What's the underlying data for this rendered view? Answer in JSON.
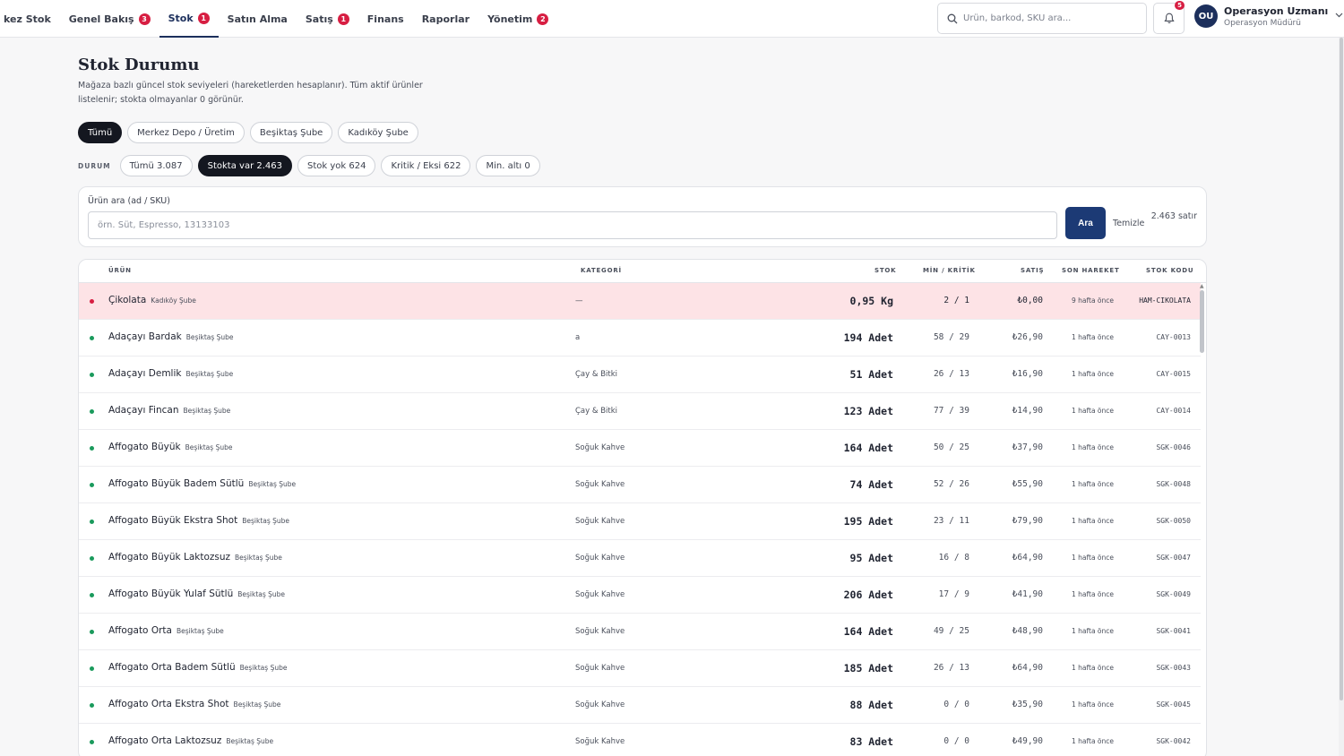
{
  "nav": {
    "items": [
      {
        "label": "kez Stok",
        "badge": ""
      },
      {
        "label": "Genel Bakış",
        "badge": "3"
      },
      {
        "label": "Stok",
        "badge": "1",
        "active": true
      },
      {
        "label": "Satın Alma",
        "badge": ""
      },
      {
        "label": "Satış",
        "badge": "1"
      },
      {
        "label": "Finans",
        "badge": ""
      },
      {
        "label": "Raporlar",
        "badge": ""
      },
      {
        "label": "Yönetim",
        "badge": "2"
      }
    ],
    "search_placeholder": "Ürün, barkod, SKU ara...",
    "notification_count": "5",
    "user": {
      "initials": "OU",
      "name": "Operasyon Uzmanı",
      "role": "Operasyon Müdürü"
    }
  },
  "header": {
    "title": "Stok Durumu",
    "description": "Mağaza bazlı güncel stok seviyeleri (hareketlerden hesaplanır). Tüm aktif ürünler listelenir; stokta olmayanlar 0 görünür."
  },
  "store_filters": [
    {
      "label": "Tümü",
      "active": true
    },
    {
      "label": "Merkez Depo / Üretim",
      "active": false
    },
    {
      "label": "Beşiktaş Şube",
      "active": false
    },
    {
      "label": "Kadıköy Şube",
      "active": false
    }
  ],
  "status": {
    "label": "DURUM",
    "filters": [
      {
        "label": "Tümü 3.087",
        "active": false
      },
      {
        "label": "Stokta var 2.463",
        "active": true
      },
      {
        "label": "Stok yok 624",
        "active": false
      },
      {
        "label": "Kritik / Eksi 622",
        "active": false
      },
      {
        "label": "Min. altı 0",
        "active": false
      }
    ]
  },
  "search": {
    "label": "Ürün ara (ad / SKU)",
    "placeholder": "örn. Süt, Espresso, 13133103",
    "value": "",
    "button": "Ara",
    "clear": "Temizle",
    "row_count": "2.463 satır"
  },
  "table": {
    "columns": {
      "product": "ÜRÜN",
      "category": "KATEGORİ",
      "stock": "STOK",
      "min": "MİN / KRİTİK",
      "price": "SATIŞ",
      "last": "SON HAREKET",
      "sku": "STOK KODU"
    },
    "rows": [
      {
        "name": "Çikolata",
        "store": "Kadıköy Şube",
        "category": "—",
        "stock": "0,95 Kg",
        "min": "2 / 1",
        "price": "₺0,00",
        "last": "9 hafta önce",
        "sku": "HAM-CIKOLATA",
        "status": "critical"
      },
      {
        "name": "Adaçayı Bardak",
        "store": "Beşiktaş Şube",
        "category": "a",
        "stock": "194 Adet",
        "min": "58 / 29",
        "price": "₺26,90",
        "last": "1 hafta önce",
        "sku": "CAY-0013",
        "status": "ok"
      },
      {
        "name": "Adaçayı Demlik",
        "store": "Beşiktaş Şube",
        "category": "Çay & Bitki",
        "stock": "51 Adet",
        "min": "26 / 13",
        "price": "₺16,90",
        "last": "1 hafta önce",
        "sku": "CAY-0015",
        "status": "ok"
      },
      {
        "name": "Adaçayı Fincan",
        "store": "Beşiktaş Şube",
        "category": "Çay & Bitki",
        "stock": "123 Adet",
        "min": "77 / 39",
        "price": "₺14,90",
        "last": "1 hafta önce",
        "sku": "CAY-0014",
        "status": "ok"
      },
      {
        "name": "Affogato Büyük",
        "store": "Beşiktaş Şube",
        "category": "Soğuk Kahve",
        "stock": "164 Adet",
        "min": "50 / 25",
        "price": "₺37,90",
        "last": "1 hafta önce",
        "sku": "SGK-0046",
        "status": "ok"
      },
      {
        "name": "Affogato Büyük Badem Sütlü",
        "store": "Beşiktaş Şube",
        "category": "Soğuk Kahve",
        "stock": "74 Adet",
        "min": "52 / 26",
        "price": "₺55,90",
        "last": "1 hafta önce",
        "sku": "SGK-0048",
        "status": "ok"
      },
      {
        "name": "Affogato Büyük Ekstra Shot",
        "store": "Beşiktaş Şube",
        "category": "Soğuk Kahve",
        "stock": "195 Adet",
        "min": "23 / 11",
        "price": "₺79,90",
        "last": "1 hafta önce",
        "sku": "SGK-0050",
        "status": "ok"
      },
      {
        "name": "Affogato Büyük Laktozsuz",
        "store": "Beşiktaş Şube",
        "category": "Soğuk Kahve",
        "stock": "95 Adet",
        "min": "16 / 8",
        "price": "₺64,90",
        "last": "1 hafta önce",
        "sku": "SGK-0047",
        "status": "ok"
      },
      {
        "name": "Affogato Büyük Yulaf Sütlü",
        "store": "Beşiktaş Şube",
        "category": "Soğuk Kahve",
        "stock": "206 Adet",
        "min": "17 / 9",
        "price": "₺41,90",
        "last": "1 hafta önce",
        "sku": "SGK-0049",
        "status": "ok"
      },
      {
        "name": "Affogato Orta",
        "store": "Beşiktaş Şube",
        "category": "Soğuk Kahve",
        "stock": "164 Adet",
        "min": "49 / 25",
        "price": "₺48,90",
        "last": "1 hafta önce",
        "sku": "SGK-0041",
        "status": "ok"
      },
      {
        "name": "Affogato Orta Badem Sütlü",
        "store": "Beşiktaş Şube",
        "category": "Soğuk Kahve",
        "stock": "185 Adet",
        "min": "26 / 13",
        "price": "₺64,90",
        "last": "1 hafta önce",
        "sku": "SGK-0043",
        "status": "ok"
      },
      {
        "name": "Affogato Orta Ekstra Shot",
        "store": "Beşiktaş Şube",
        "category": "Soğuk Kahve",
        "stock": "88 Adet",
        "min": "0 / 0",
        "price": "₺35,90",
        "last": "1 hafta önce",
        "sku": "SGK-0045",
        "status": "ok"
      },
      {
        "name": "Affogato Orta Laktozsuz",
        "store": "Beşiktaş Şube",
        "category": "Soğuk Kahve",
        "stock": "83 Adet",
        "min": "0 / 0",
        "price": "₺49,90",
        "last": "1 hafta önce",
        "sku": "SGK-0042",
        "status": "ok"
      }
    ]
  },
  "colors": {
    "accent": "#1c3a75",
    "badge": "#d71e42",
    "ok": "#1a9a5c",
    "critical_row": "#fde3e6"
  }
}
